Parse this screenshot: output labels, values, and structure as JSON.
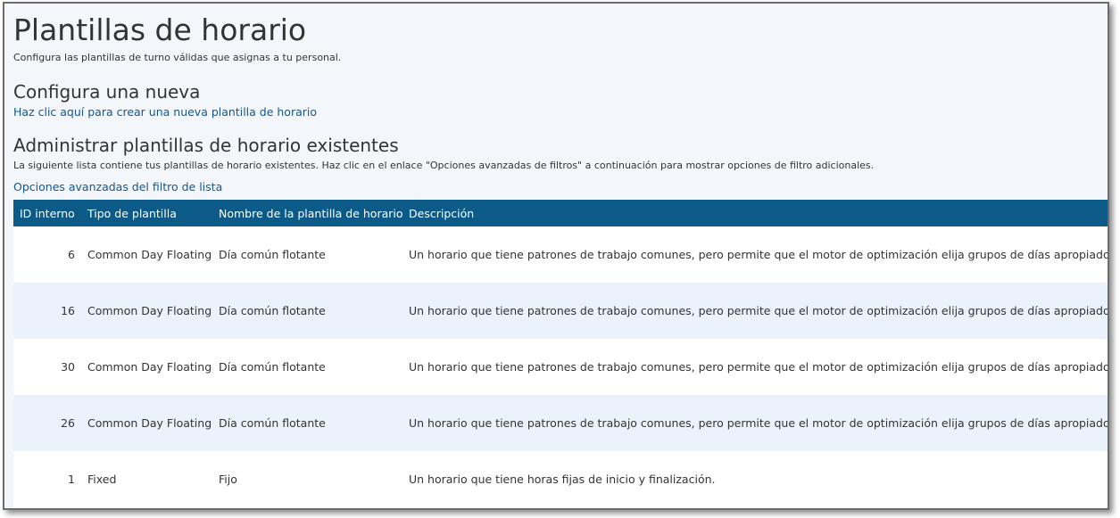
{
  "page": {
    "title": "Plantillas de horario",
    "subtitle": "Configura las plantillas de turno válidas que asignas a tu personal."
  },
  "new_section": {
    "heading": "Configura una nueva",
    "link": "Haz clic aquí para crear una nueva plantilla de horario"
  },
  "admin_section": {
    "heading": "Administrar plantillas de horario existentes",
    "description": "La siguiente lista contiene tus plantillas de horario existentes. Haz clic en el enlace \"Opciones avanzadas de filtros\" a continuación para mostrar opciones de filtro adicionales.",
    "filter_link": "Opciones avanzadas del filtro de lista"
  },
  "table": {
    "headers": [
      "ID interno",
      "Tipo de plantilla",
      "Nombre de la plantilla de horario",
      "Descripción"
    ],
    "rows": [
      {
        "id": "6",
        "type": "Common Day Floating",
        "name": "Día común flotante",
        "desc": "Un horario que tiene patrones de trabajo comunes, pero permite que el motor de optimización elija grupos de días apropiados. T"
      },
      {
        "id": "16",
        "type": "Common Day Floating",
        "name": "Día común flotante",
        "desc": "Un horario que tiene patrones de trabajo comunes, pero permite que el motor de optimización elija grupos de días apropiados. T"
      },
      {
        "id": "30",
        "type": "Common Day Floating",
        "name": "Día común flotante",
        "desc": "Un horario que tiene patrones de trabajo comunes, pero permite que el motor de optimización elija grupos de días apropiados. T"
      },
      {
        "id": "26",
        "type": "Common Day Floating",
        "name": "Día común flotante",
        "desc": "Un horario que tiene patrones de trabajo comunes, pero permite que el motor de optimización elija grupos de días apropiados. T"
      },
      {
        "id": "1",
        "type": "Fixed",
        "name": "Fijo",
        "desc": "Un horario que tiene horas fijas de inicio y finalización."
      }
    ]
  },
  "colors": {
    "header_bg": "#0c5a88",
    "link": "#10588e",
    "row_alt": "#eaf3fb",
    "page_bg": "#f3f6fb"
  }
}
